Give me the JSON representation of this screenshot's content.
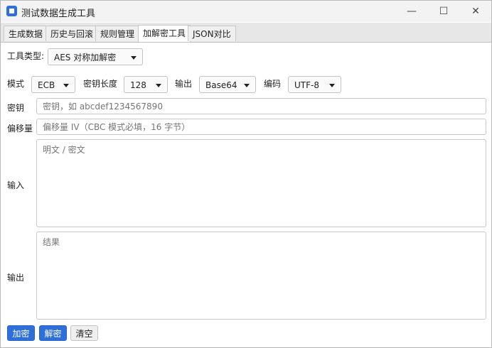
{
  "window": {
    "title": "测试数据生成工具",
    "min_glyph": "—",
    "max_glyph": "☐",
    "close_glyph": "✕"
  },
  "tabs": [
    {
      "label": "生成数据"
    },
    {
      "label": "历史与回滚"
    },
    {
      "label": "规则管理"
    },
    {
      "label": "加解密工具"
    },
    {
      "label": "JSON对比"
    }
  ],
  "active_tab": "加解密工具",
  "tool_type": {
    "label": "工具类型:",
    "value": "AES 对称加解密"
  },
  "options": {
    "mode": {
      "label": "模式",
      "value": "ECB"
    },
    "key_length": {
      "label": "密钥长度",
      "value": "128"
    },
    "output": {
      "label": "输出",
      "value": "Base64"
    },
    "encoding": {
      "label": "编码",
      "value": "UTF-8"
    }
  },
  "key": {
    "label": "密钥",
    "placeholder": "密钥，如 abcdef1234567890"
  },
  "iv": {
    "label": "偏移量",
    "placeholder": "偏移量 IV（CBC 模式必填，16 字节）"
  },
  "input": {
    "label": "输入",
    "placeholder": "明文 / 密文"
  },
  "result": {
    "label": "输出",
    "placeholder": "结果"
  },
  "buttons": {
    "encrypt": "加密",
    "decrypt": "解密",
    "clear": "清空"
  },
  "colors": {
    "accent": "#2f6fda"
  }
}
